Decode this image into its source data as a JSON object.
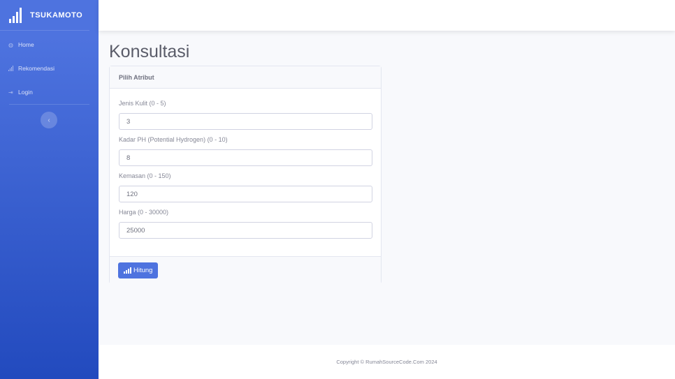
{
  "sidebar": {
    "brand": "TSUKAMOTO",
    "items": [
      {
        "label": "Home",
        "icon": "dashboard-icon"
      },
      {
        "label": "Rekomendasi",
        "icon": "signal-icon"
      },
      {
        "label": "Login",
        "icon": "login-icon"
      }
    ],
    "toggle_icon": "chevron-left-icon"
  },
  "main": {
    "title": "Konsultasi",
    "card": {
      "header": "Pilih Atribut",
      "fields": [
        {
          "label": "Jenis Kulit (0 - 5)",
          "value": "3"
        },
        {
          "label": "Kadar PH (Potential Hydrogen) (0 - 10)",
          "value": "8"
        },
        {
          "label": "Kemasan (0 - 150)",
          "value": "120"
        },
        {
          "label": "Harga (0 - 30000)",
          "value": "25000"
        }
      ],
      "button": "Hitung"
    }
  },
  "footer": {
    "copyright": "Copyright © RumahSourceCode.Com 2024"
  },
  "colors": {
    "primary": "#4e73df",
    "sidebar_bottom": "#224abe",
    "background": "#f8f9fc"
  }
}
